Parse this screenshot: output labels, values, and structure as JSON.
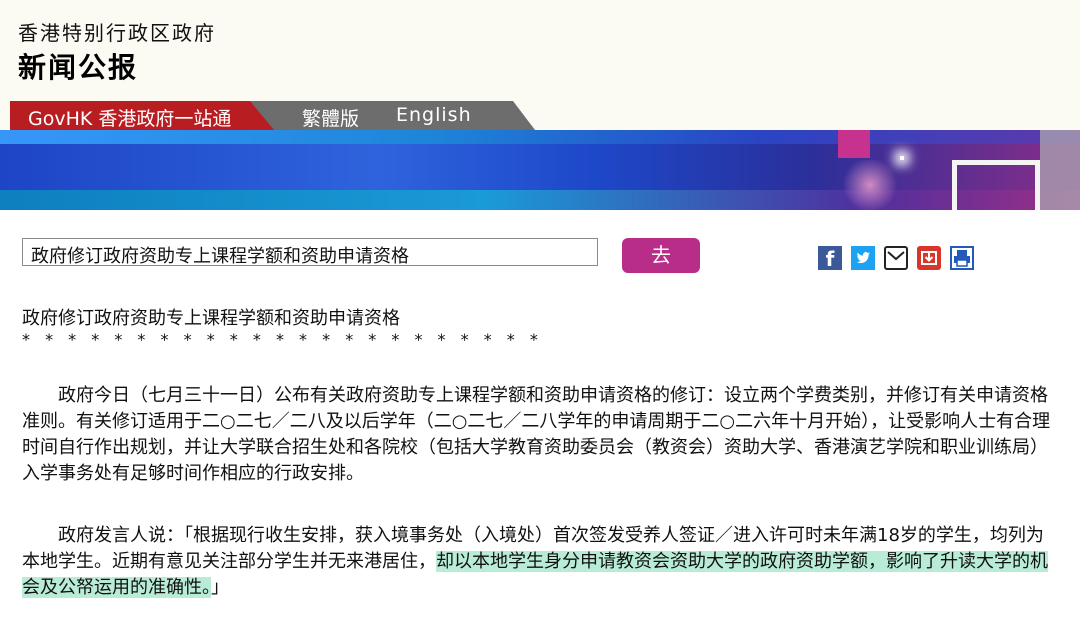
{
  "header": {
    "gov_name": "香港特别行政区政府",
    "press_title": "新闻公报"
  },
  "nav": {
    "govhk": "GovHK 香港政府一站通",
    "traditional": "繁體版",
    "english": "English"
  },
  "toolbar": {
    "select_value": "政府修订政府资助专上课程学额和资助申请资格",
    "go_label": "去",
    "share_icons": [
      "facebook-icon",
      "twitter-icon",
      "email-icon",
      "download-icon",
      "print-icon"
    ]
  },
  "article": {
    "title": "政府修订政府资助专上课程学额和资助申请资格",
    "stars": "* * * * * * * * * * * * * * * * * * * * * * *",
    "para1": "政府今日（七月三十一日）公布有关政府资助专上课程学额和资助申请资格的修订：设立两个学费类别，并修订有关申请资格准则。有关修订适用于二○二七／二八及以后学年（二○二七／二八学年的申请周期于二○二六年十月开始），让受影响人士有合理时间自行作出规划，并让大学联合招生处和各院校（包括大学教育资助委员会（教资会）资助大学、香港演艺学院和职业训练局）入学事务处有足够时间作相应的行政安排。",
    "para2_plain": "政府发言人说：「根据现行收生安排，获入境事务处（入境处）首次签发受养人签证／进入许可时未年满18岁的学生，均列为本地学生。近期有意见关注部分学生并无来港居住，",
    "para2_highlight": "却以本地学生身分申请教资会资助大学的政府资助学额，影响了升读大学的机会及公帑运用的准确性。",
    "para2_end": "」"
  },
  "colors": {
    "brand_red": "#b81d22",
    "nav_grey": "#6d6d6d",
    "go_button": "#b82d88",
    "highlight": "#b9ecd7"
  }
}
